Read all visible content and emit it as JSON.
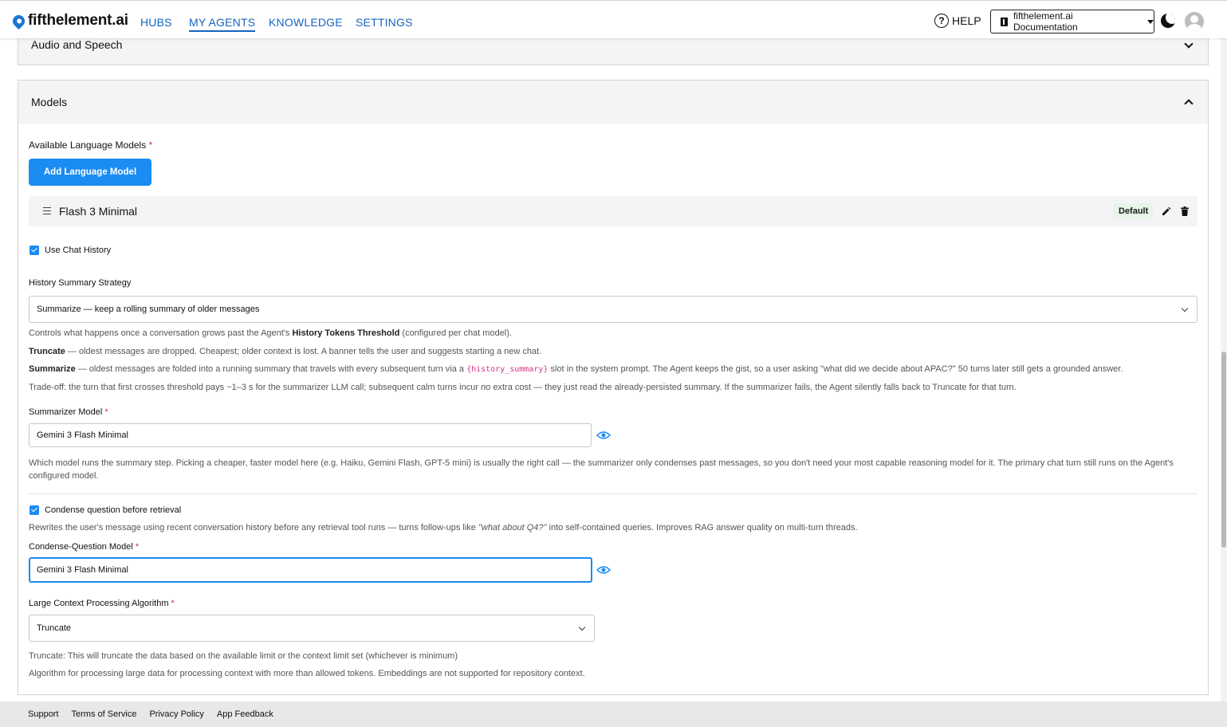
{
  "brand": {
    "name": "fifthelement.ai"
  },
  "nav": {
    "hubs": "HUBS",
    "my_agents": "MY AGENTS",
    "knowledge": "KNOWLEDGE",
    "settings": "SETTINGS"
  },
  "header": {
    "help": "HELP",
    "docs": "fifthelement.ai Documentation"
  },
  "audio_section": {
    "title": "Audio and Speech"
  },
  "models_section": {
    "title": "Models",
    "available_label": "Available Language Models",
    "required_mark": "*",
    "add_button": "Add Language Model",
    "model_row": {
      "name": "Flash 3 Minimal",
      "badge": "Default"
    },
    "use_chat_history": {
      "label": "Use Chat History",
      "checked": true
    },
    "history_strategy": {
      "label": "History Summary Strategy",
      "value": "Summarize — keep a rolling summary of older messages"
    },
    "help": {
      "intro_before": "Controls what happens once a conversation grows past the Agent's ",
      "intro_bold": "History Tokens Threshold",
      "intro_after": " (configured per chat model).",
      "truncate_bold": "Truncate",
      "truncate_text": " — oldest messages are dropped. Cheapest; older context is lost. A banner tells the user and suggests starting a new chat.",
      "summarize_bold": "Summarize",
      "summarize_before": " — oldest messages are folded into a running summary that travels with every subsequent turn via a ",
      "summarize_code": "{history_summary}",
      "summarize_after": " slot in the system prompt. The Agent keeps the gist, so a user asking \"what did we decide about APAC?\" 50 turns later still gets a grounded answer.",
      "tradeoff_before": "Trade-off: the turn that first crosses threshold pays ~1–3 s for the summarizer LLM call; subsequent calm turns incur ",
      "tradeoff_em": "no",
      "tradeoff_after": " extra cost — they just read the already-persisted summary. If the summarizer fails, the Agent silently falls back to Truncate for that turn."
    },
    "summarizer": {
      "label": "Summarizer Model",
      "value": "Gemini 3 Flash Minimal",
      "help": "Which model runs the summary step. Picking a cheaper, faster model here (e.g. Haiku, Gemini Flash, GPT-5 mini) is usually the right call — the summarizer only condenses past messages, so you don't need your most capable reasoning model for it. The primary chat turn still runs on the Agent's configured model."
    },
    "condense": {
      "label": "Condense question before retrieval",
      "checked": true,
      "help_before": "Rewrites the user's message using recent conversation history before any retrieval tool runs — turns follow-ups like ",
      "help_em": "\"what about Q4?\"",
      "help_after": " into self-contained queries. Improves RAG answer quality on multi-turn threads.",
      "model_label": "Condense-Question Model",
      "model_value": "Gemini 3 Flash Minimal"
    },
    "large_context": {
      "label": "Large Context Processing Algorithm",
      "value": "Truncate",
      "help1": "Truncate: This will truncate the data based on the available limit or the context limit set (whichever is minimum)",
      "help2": "Algorithm for processing large data for processing context with more than allowed tokens. Embeddings are not supported for repository context."
    }
  },
  "footer": {
    "support": "Support",
    "terms": "Terms of Service",
    "privacy": "Privacy Policy",
    "feedback": "App Feedback"
  },
  "colors": {
    "primary": "#1a8cf2",
    "nav_link": "#1565c0",
    "required": "#d32f2f",
    "badge_bg": "#e6f4ea",
    "code": "#d63384"
  },
  "icons": [
    "logo-icon",
    "help-icon",
    "book-icon",
    "moon-icon",
    "avatar-icon",
    "chevron-down-icon",
    "chevron-up-icon",
    "drag-handle-icon",
    "pencil-icon",
    "trash-icon",
    "check-icon",
    "eye-icon"
  ]
}
